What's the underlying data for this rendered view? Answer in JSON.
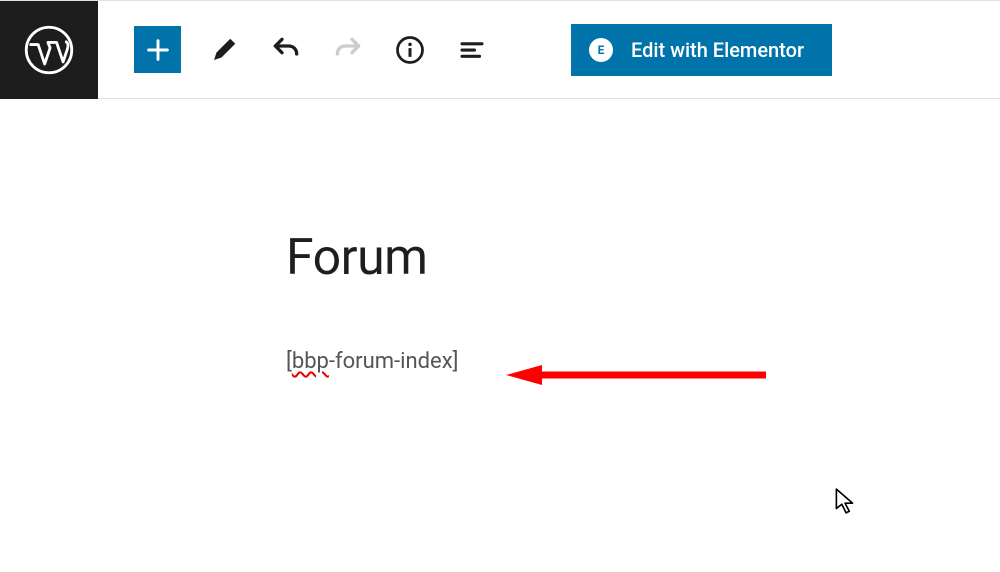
{
  "toolbar": {
    "elementor_label": "Edit with Elementor",
    "elementor_badge": "E"
  },
  "editor": {
    "title": "Forum",
    "shortcode_bracket_open": "[",
    "shortcode_bbp": "bbp",
    "shortcode_rest": "-forum-index]"
  }
}
